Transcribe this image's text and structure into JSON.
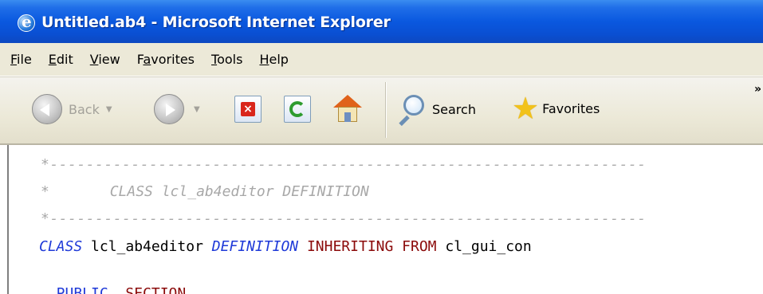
{
  "window": {
    "title": "Untitled.ab4 - Microsoft Internet Explorer"
  },
  "menu": {
    "items": [
      {
        "label": "File",
        "accel": "F",
        "rest": "ile"
      },
      {
        "label": "Edit",
        "accel": "E",
        "rest": "dit"
      },
      {
        "label": "View",
        "accel": "V",
        "rest": "iew"
      },
      {
        "label": "Favorites",
        "pre": "F",
        "accel": "a",
        "rest": "vorites"
      },
      {
        "label": "Tools",
        "accel": "T",
        "rest": "ools"
      },
      {
        "label": "Help",
        "accel": "H",
        "rest": "elp"
      }
    ]
  },
  "toolbar": {
    "back_label": "Back",
    "search_label": "Search",
    "favorites_label": "Favorites",
    "overflow": "»",
    "icons": [
      "back-arrow-icon",
      "forward-arrow-icon",
      "stop-icon",
      "refresh-icon",
      "home-icon",
      "search-icon",
      "favorites-star-icon"
    ]
  },
  "code": {
    "divider1": "*------------------------------------------------------------------",
    "comment_line": "*       CLASS lcl_ab4editor DEFINITION",
    "divider2": "*------------------------------------------------------------------",
    "class_kw": "CLASS",
    "class_name": " lcl_ab4editor ",
    "definition_kw": "DEFINITION",
    "inheriting_kw": " INHERITING FROM",
    "super_name": " cl_gui_con",
    "public_kw": "  PUBLIC",
    "section_kw": "  SECTION"
  },
  "colors": {
    "titlebar": "#0a58df",
    "menubar": "#ece9d8",
    "comment": "#a8a8a8",
    "keyword_blue": "#1f3ad8",
    "keyword_red": "#8b0a0a"
  }
}
